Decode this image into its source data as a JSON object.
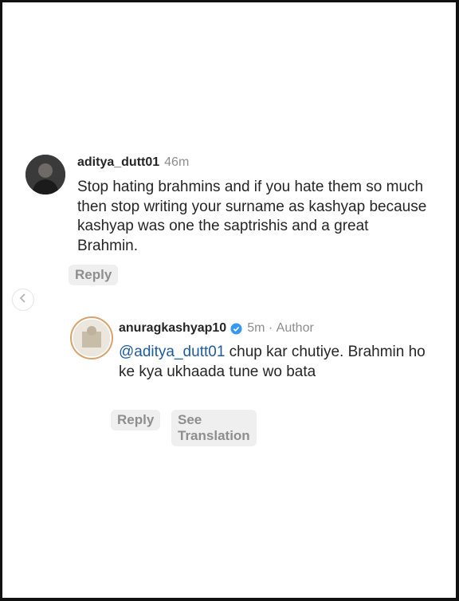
{
  "nav": {
    "prev_icon": "chevron-left-icon"
  },
  "comments": [
    {
      "username": "aditya_dutt01",
      "time": "46m",
      "text": "Stop hating brahmins and if you hate them so much then stop writing your surname as kashyap because  kashyap was one the saptrishis and a great Brahmin.",
      "reply_label": "Reply"
    },
    {
      "username": "anuragkashyap10",
      "time": "5m",
      "separator": "·",
      "role": "Author",
      "mention": "@aditya_dutt01",
      "text": " chup kar chutiye. Brahmin ho ke kya ukhaada tune wo bata",
      "reply_label": "Reply",
      "translate_label": "See Translation",
      "verified_icon": "verified-badge-icon"
    }
  ],
  "colors": {
    "mention": "#1f5aa0",
    "verified": "#3897f0",
    "muted": "#8e8e8e"
  }
}
